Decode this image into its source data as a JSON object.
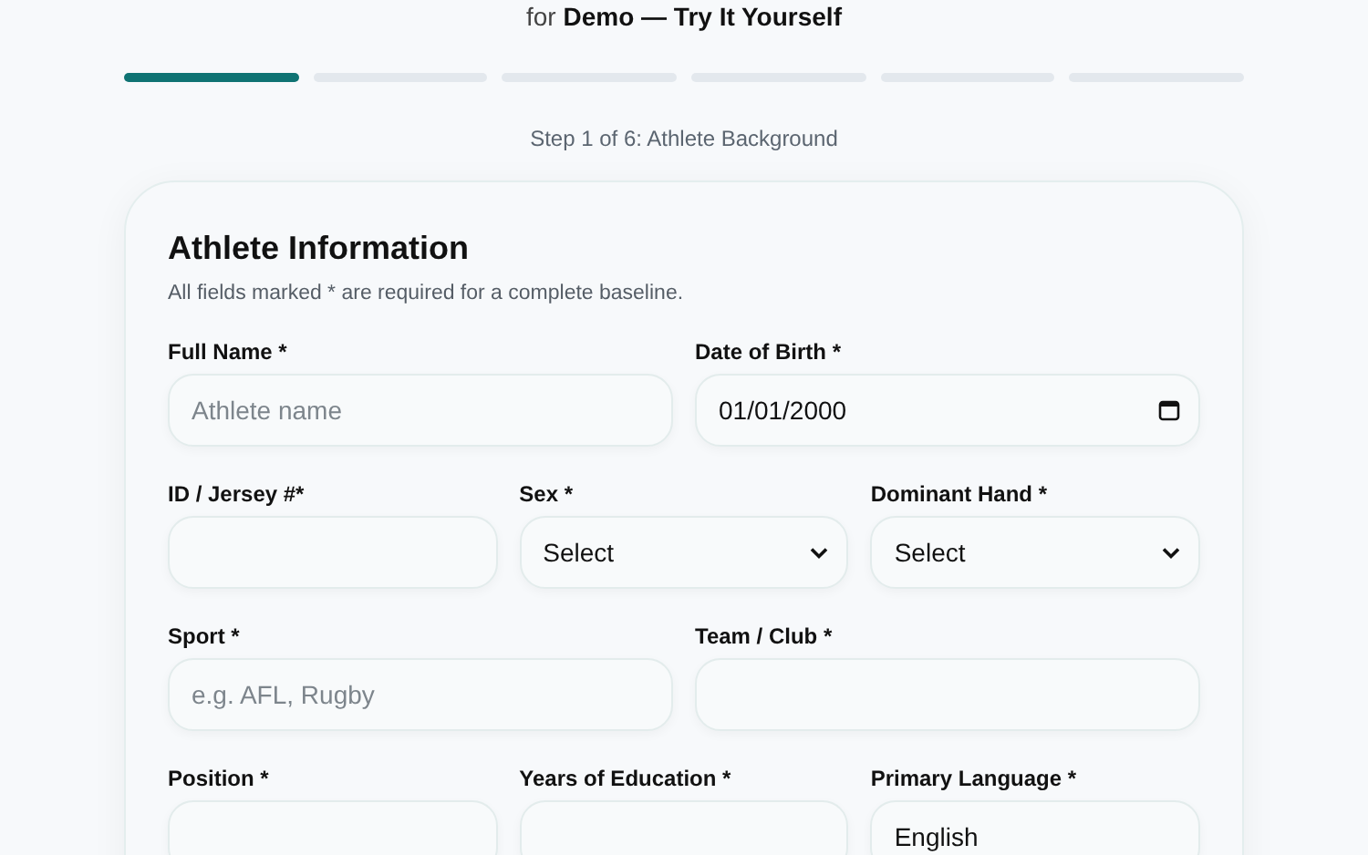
{
  "header": {
    "subtitle": "for **Demo — Try It Yourself**"
  },
  "progress": {
    "steps": [
      {
        "completed": true
      },
      {
        "completed": false
      },
      {
        "completed": false
      },
      {
        "completed": false
      },
      {
        "completed": false
      },
      {
        "completed": false
      }
    ],
    "label": "Step 1 of 6: Athlete Background"
  },
  "card": {
    "title": "Athlete Information",
    "note": "All fields marked * are required for a complete baseline.",
    "rows": [
      [
        {
          "label": "Full Name *",
          "kind": "text",
          "placeholder": "Athlete name"
        },
        {
          "label": "Date of Birth *",
          "kind": "date",
          "value": "01/01/2000"
        }
      ],
      [
        {
          "label": "ID / Jersey #*",
          "kind": "text"
        },
        {
          "label": "Sex *",
          "kind": "select",
          "value": "Select"
        },
        {
          "label": "Dominant Hand *",
          "kind": "select",
          "value": "Select"
        }
      ],
      [
        {
          "label": "Sport *",
          "kind": "text",
          "placeholder": "e.g. AFL, Rugby"
        },
        {
          "label": "Team / Club *",
          "kind": "text"
        }
      ],
      [
        {
          "label": "Position *",
          "kind": "text"
        },
        {
          "label": "Years of Education *",
          "kind": "text"
        },
        {
          "label": "Primary Language *",
          "kind": "text",
          "value": "English"
        }
      ]
    ]
  }
}
